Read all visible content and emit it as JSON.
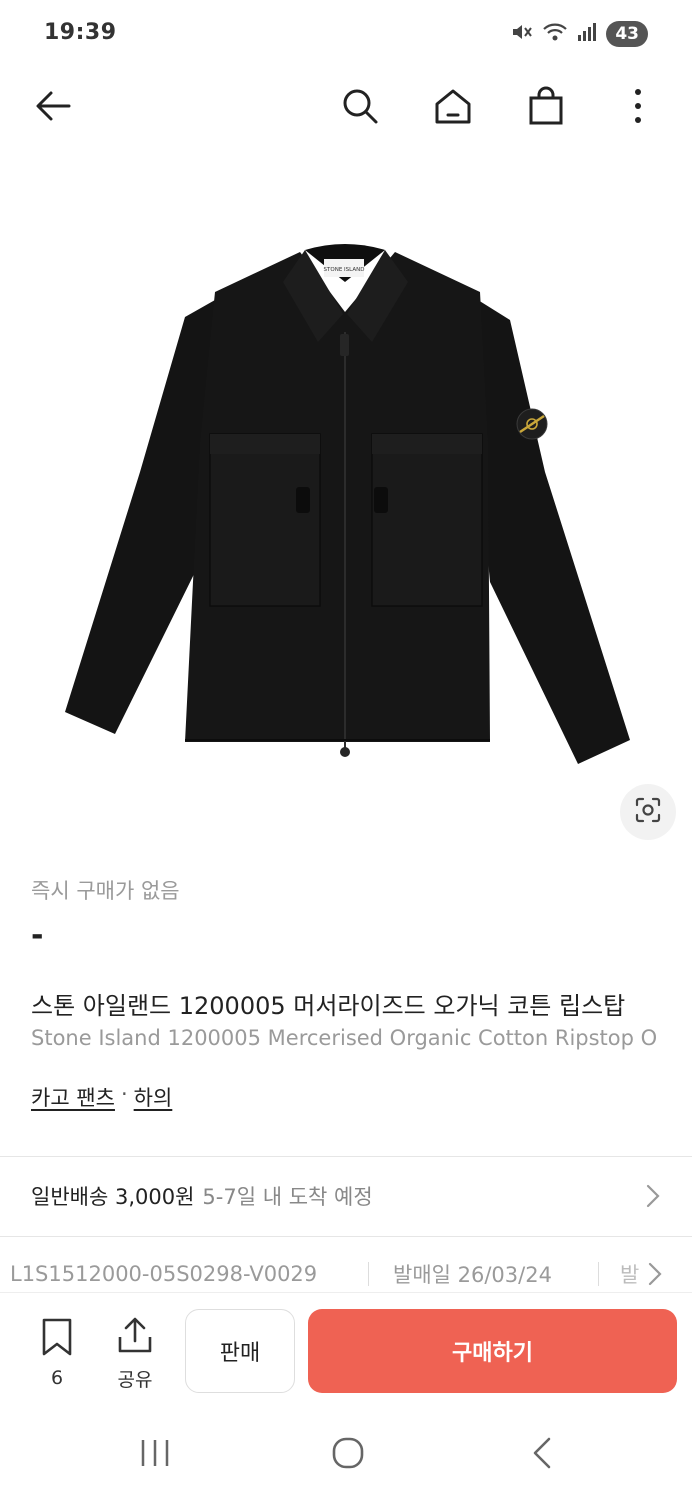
{
  "status_bar": {
    "time": "19:39",
    "battery": "43",
    "icons": [
      "mute-icon",
      "wifi-icon",
      "signal-icon"
    ]
  },
  "nav": {
    "icons": [
      "back-arrow-icon",
      "search-icon",
      "home-icon",
      "shopping-bag-icon",
      "more-vertical-icon"
    ]
  },
  "product": {
    "image_label": "STONE ISLAND",
    "instant_purchase_label": "즉시 구매가 없음",
    "price": "-",
    "name_ko": "스톤 아일랜드 1200005 머서라이즈드 오가닉 코튼 립스탑",
    "name_en": "Stone Island 1200005 Mercerised Organic Cotton Ripstop O",
    "category_main": "카고 팬츠",
    "category_separator": "·",
    "category_sub": "하의"
  },
  "shipping": {
    "main": "일반배송 3,000원",
    "sub": "5-7일 내 도착 예정"
  },
  "specs": {
    "model_number": "L1S1512000-05S0298-V0029",
    "release_date": "발매일 26/03/24",
    "more": "발"
  },
  "actions": {
    "bookmark_count": "6",
    "share_label": "공유",
    "sell_label": "판매",
    "buy_label": "구매하기"
  },
  "colors": {
    "buy_button": "#ef6253",
    "jacket": "#141414",
    "text_muted": "#9a9a9a"
  },
  "system_nav": {
    "icons": [
      "recent-apps-icon",
      "home-circle-icon",
      "system-back-icon"
    ]
  }
}
